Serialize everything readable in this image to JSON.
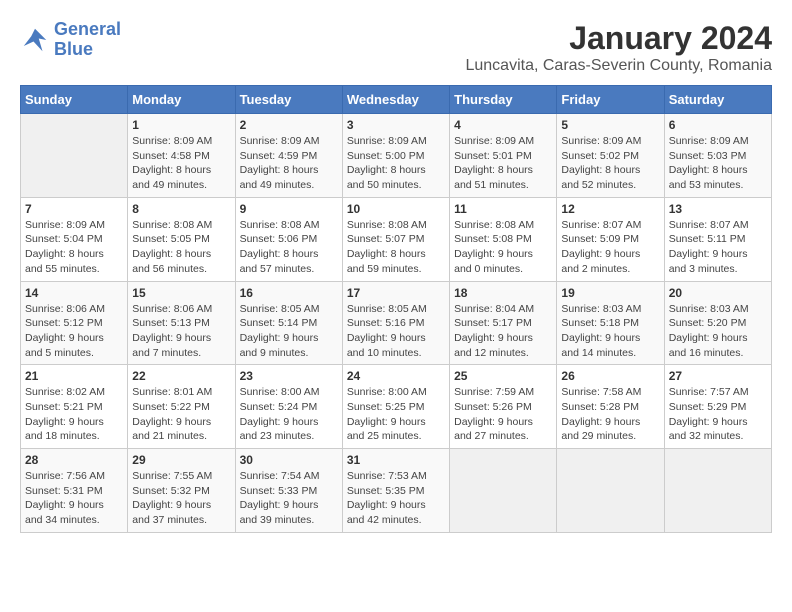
{
  "logo": {
    "line1": "General",
    "line2": "Blue"
  },
  "title": "January 2024",
  "location": "Luncavita, Caras-Severin County, Romania",
  "weekdays": [
    "Sunday",
    "Monday",
    "Tuesday",
    "Wednesday",
    "Thursday",
    "Friday",
    "Saturday"
  ],
  "weeks": [
    [
      {
        "day": "",
        "sunrise": "",
        "sunset": "",
        "daylight": ""
      },
      {
        "day": "1",
        "sunrise": "Sunrise: 8:09 AM",
        "sunset": "Sunset: 4:58 PM",
        "daylight": "Daylight: 8 hours and 49 minutes."
      },
      {
        "day": "2",
        "sunrise": "Sunrise: 8:09 AM",
        "sunset": "Sunset: 4:59 PM",
        "daylight": "Daylight: 8 hours and 49 minutes."
      },
      {
        "day": "3",
        "sunrise": "Sunrise: 8:09 AM",
        "sunset": "Sunset: 5:00 PM",
        "daylight": "Daylight: 8 hours and 50 minutes."
      },
      {
        "day": "4",
        "sunrise": "Sunrise: 8:09 AM",
        "sunset": "Sunset: 5:01 PM",
        "daylight": "Daylight: 8 hours and 51 minutes."
      },
      {
        "day": "5",
        "sunrise": "Sunrise: 8:09 AM",
        "sunset": "Sunset: 5:02 PM",
        "daylight": "Daylight: 8 hours and 52 minutes."
      },
      {
        "day": "6",
        "sunrise": "Sunrise: 8:09 AM",
        "sunset": "Sunset: 5:03 PM",
        "daylight": "Daylight: 8 hours and 53 minutes."
      }
    ],
    [
      {
        "day": "7",
        "sunrise": "Sunrise: 8:09 AM",
        "sunset": "Sunset: 5:04 PM",
        "daylight": "Daylight: 8 hours and 55 minutes."
      },
      {
        "day": "8",
        "sunrise": "Sunrise: 8:08 AM",
        "sunset": "Sunset: 5:05 PM",
        "daylight": "Daylight: 8 hours and 56 minutes."
      },
      {
        "day": "9",
        "sunrise": "Sunrise: 8:08 AM",
        "sunset": "Sunset: 5:06 PM",
        "daylight": "Daylight: 8 hours and 57 minutes."
      },
      {
        "day": "10",
        "sunrise": "Sunrise: 8:08 AM",
        "sunset": "Sunset: 5:07 PM",
        "daylight": "Daylight: 8 hours and 59 minutes."
      },
      {
        "day": "11",
        "sunrise": "Sunrise: 8:08 AM",
        "sunset": "Sunset: 5:08 PM",
        "daylight": "Daylight: 9 hours and 0 minutes."
      },
      {
        "day": "12",
        "sunrise": "Sunrise: 8:07 AM",
        "sunset": "Sunset: 5:09 PM",
        "daylight": "Daylight: 9 hours and 2 minutes."
      },
      {
        "day": "13",
        "sunrise": "Sunrise: 8:07 AM",
        "sunset": "Sunset: 5:11 PM",
        "daylight": "Daylight: 9 hours and 3 minutes."
      }
    ],
    [
      {
        "day": "14",
        "sunrise": "Sunrise: 8:06 AM",
        "sunset": "Sunset: 5:12 PM",
        "daylight": "Daylight: 9 hours and 5 minutes."
      },
      {
        "day": "15",
        "sunrise": "Sunrise: 8:06 AM",
        "sunset": "Sunset: 5:13 PM",
        "daylight": "Daylight: 9 hours and 7 minutes."
      },
      {
        "day": "16",
        "sunrise": "Sunrise: 8:05 AM",
        "sunset": "Sunset: 5:14 PM",
        "daylight": "Daylight: 9 hours and 9 minutes."
      },
      {
        "day": "17",
        "sunrise": "Sunrise: 8:05 AM",
        "sunset": "Sunset: 5:16 PM",
        "daylight": "Daylight: 9 hours and 10 minutes."
      },
      {
        "day": "18",
        "sunrise": "Sunrise: 8:04 AM",
        "sunset": "Sunset: 5:17 PM",
        "daylight": "Daylight: 9 hours and 12 minutes."
      },
      {
        "day": "19",
        "sunrise": "Sunrise: 8:03 AM",
        "sunset": "Sunset: 5:18 PM",
        "daylight": "Daylight: 9 hours and 14 minutes."
      },
      {
        "day": "20",
        "sunrise": "Sunrise: 8:03 AM",
        "sunset": "Sunset: 5:20 PM",
        "daylight": "Daylight: 9 hours and 16 minutes."
      }
    ],
    [
      {
        "day": "21",
        "sunrise": "Sunrise: 8:02 AM",
        "sunset": "Sunset: 5:21 PM",
        "daylight": "Daylight: 9 hours and 18 minutes."
      },
      {
        "day": "22",
        "sunrise": "Sunrise: 8:01 AM",
        "sunset": "Sunset: 5:22 PM",
        "daylight": "Daylight: 9 hours and 21 minutes."
      },
      {
        "day": "23",
        "sunrise": "Sunrise: 8:00 AM",
        "sunset": "Sunset: 5:24 PM",
        "daylight": "Daylight: 9 hours and 23 minutes."
      },
      {
        "day": "24",
        "sunrise": "Sunrise: 8:00 AM",
        "sunset": "Sunset: 5:25 PM",
        "daylight": "Daylight: 9 hours and 25 minutes."
      },
      {
        "day": "25",
        "sunrise": "Sunrise: 7:59 AM",
        "sunset": "Sunset: 5:26 PM",
        "daylight": "Daylight: 9 hours and 27 minutes."
      },
      {
        "day": "26",
        "sunrise": "Sunrise: 7:58 AM",
        "sunset": "Sunset: 5:28 PM",
        "daylight": "Daylight: 9 hours and 29 minutes."
      },
      {
        "day": "27",
        "sunrise": "Sunrise: 7:57 AM",
        "sunset": "Sunset: 5:29 PM",
        "daylight": "Daylight: 9 hours and 32 minutes."
      }
    ],
    [
      {
        "day": "28",
        "sunrise": "Sunrise: 7:56 AM",
        "sunset": "Sunset: 5:31 PM",
        "daylight": "Daylight: 9 hours and 34 minutes."
      },
      {
        "day": "29",
        "sunrise": "Sunrise: 7:55 AM",
        "sunset": "Sunset: 5:32 PM",
        "daylight": "Daylight: 9 hours and 37 minutes."
      },
      {
        "day": "30",
        "sunrise": "Sunrise: 7:54 AM",
        "sunset": "Sunset: 5:33 PM",
        "daylight": "Daylight: 9 hours and 39 minutes."
      },
      {
        "day": "31",
        "sunrise": "Sunrise: 7:53 AM",
        "sunset": "Sunset: 5:35 PM",
        "daylight": "Daylight: 9 hours and 42 minutes."
      },
      {
        "day": "",
        "sunrise": "",
        "sunset": "",
        "daylight": ""
      },
      {
        "day": "",
        "sunrise": "",
        "sunset": "",
        "daylight": ""
      },
      {
        "day": "",
        "sunrise": "",
        "sunset": "",
        "daylight": ""
      }
    ]
  ]
}
